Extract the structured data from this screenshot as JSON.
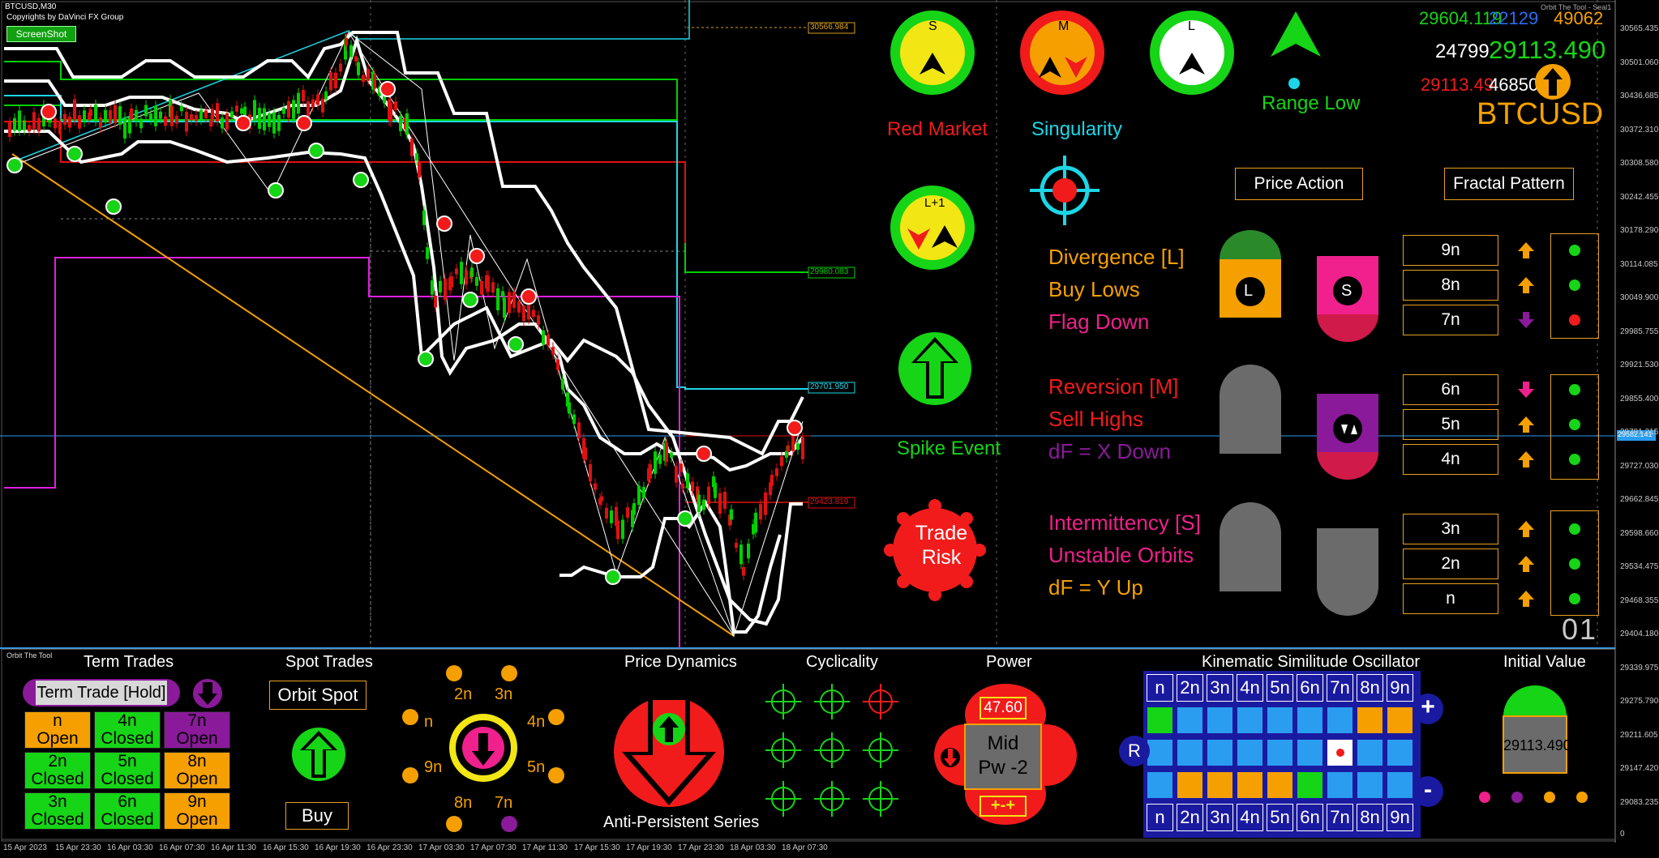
{
  "window": {
    "symbol": "BTCUSD,M30",
    "copyright": "Copyrights by DaVinci FX Group",
    "screenshot_button": "ScreenShot",
    "indicator_name_top": "Orbit The Tool - Seal1",
    "indicator_name_bottom": "Orbit The Tool"
  },
  "prices": {
    "p1": "29604.119",
    "p2": "22129",
    "p3": "49062",
    "count": "24799",
    "big_price": "29113.490",
    "red_price": "29113.49",
    "p4": "468500",
    "symbol": "BTCUSD",
    "counter": "01"
  },
  "chart_levels": {
    "l1": "30566.984",
    "l2": "29980.083",
    "l3": "29701.950",
    "l4": "29423.819",
    "current": "29582.141"
  },
  "y_axis": [
    "30565.435",
    "30501.060",
    "30436.685",
    "30372.310",
    "30308.580",
    "30242.455",
    "30178.290",
    "30114.085",
    "30049.900",
    "29985.755",
    "29921.530",
    "29855.400",
    "29791.215",
    "29727.030",
    "29662.845",
    "29598.660",
    "29534.475",
    "29468.355",
    "29404.180",
    "29339.975",
    "29275.790",
    "29211.605",
    "29147.420",
    "29083.235",
    "0"
  ],
  "x_axis": [
    "15 Apr 2023",
    "15 Apr 23:30",
    "16 Apr 03:30",
    "16 Apr 07:30",
    "16 Apr 11:30",
    "16 Apr 15:30",
    "16 Apr 19:30",
    "16 Apr 23:30",
    "17 Apr 03:30",
    "17 Apr 07:30",
    "17 Apr 11:30",
    "17 Apr 15:30",
    "17 Apr 19:30",
    "17 Apr 23:30",
    "18 Apr 03:30",
    "18 Apr 07:30"
  ],
  "circles": {
    "s": "S",
    "m": "M",
    "l": "L",
    "l1": "L+1"
  },
  "signals": {
    "red_market": "Red Market",
    "singularity": "Singularity",
    "range_low": "Range Low",
    "spike_event": "Spike Event",
    "trade_risk_1": "Trade",
    "trade_risk_2": "Risk"
  },
  "buttons": {
    "price_action": "Price Action",
    "fractal_pattern": "Fractal Pattern"
  },
  "phases": {
    "divergence": "Divergence [L]",
    "buy_lows": "Buy Lows",
    "flag_down": "Flag Down",
    "reversion": "Reversion [M]",
    "sell_highs": "Sell Highs",
    "df_x": "dF = X Down",
    "intermittency": "Intermittency [S]",
    "unstable": "Unstable Orbits",
    "df_y": "dF = Y Up"
  },
  "badges": {
    "l": "L",
    "s": "S"
  },
  "nlevels": [
    "9n",
    "8n",
    "7n",
    "6n",
    "5n",
    "4n",
    "3n",
    "2n",
    "n"
  ],
  "bottom": {
    "term_trades": "Term Trades",
    "term_trade_hold": "Term Trade [Hold]",
    "spot_trades": "Spot Trades",
    "orbit_spot": "Orbit Spot",
    "buy": "Buy",
    "price_dynamics": "Price Dynamics",
    "anti_persistent": "Anti-Persistent Series",
    "cyclicality": "Cyclicality",
    "power": "Power",
    "power_value": "47.60",
    "power_mid_1": "Mid",
    "power_mid_2": "Pw -2",
    "power_bottom": "+-+",
    "kso": "Kinematic Similitude Oscillator",
    "initial_value": "Initial Value",
    "initial_price": "29113.490",
    "r": "R",
    "plus": "+",
    "minus": "-"
  },
  "term_grid": [
    [
      "n",
      "Open"
    ],
    [
      "4n",
      "Closed"
    ],
    [
      "7n",
      "Open"
    ],
    [
      "2n",
      "Closed"
    ],
    [
      "5n",
      "Closed"
    ],
    [
      "8n",
      "Open"
    ],
    [
      "3n",
      "Closed"
    ],
    [
      "6n",
      "Closed"
    ],
    [
      "9n",
      "Open"
    ]
  ],
  "orbit_labels": [
    "2n",
    "3n",
    "n",
    "4n",
    "9n",
    "5n",
    "8n",
    "7n"
  ],
  "kso_headers": [
    "n",
    "2n",
    "3n",
    "4n",
    "5n",
    "6n",
    "7n",
    "8n",
    "9n"
  ],
  "colors": {
    "orange": "#f5a000",
    "green": "#16d416",
    "red": "#f21b1b",
    "magenta": "#f0208c",
    "purple": "#8a1a9a",
    "cyan": "#1cd6e6",
    "blue": "#2a9df0"
  }
}
